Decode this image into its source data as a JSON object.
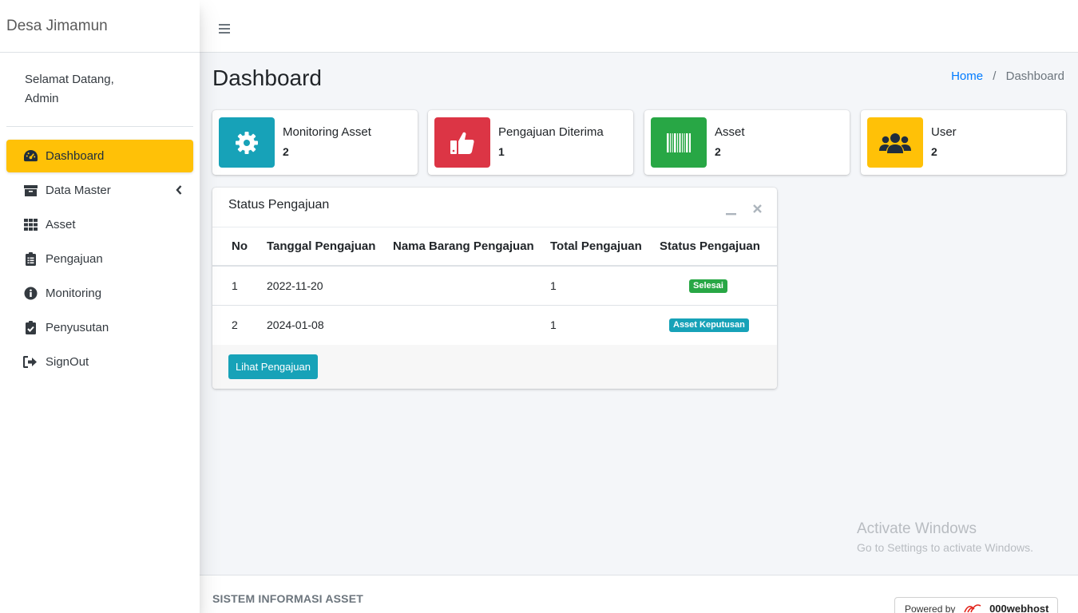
{
  "brand": "Desa Jimamun",
  "user_panel": {
    "line1": "Selamat Datang,",
    "line2": "Admin"
  },
  "sidebar": {
    "items": [
      {
        "label": "Dashboard",
        "icon": "tachometer-icon"
      },
      {
        "label": "Data Master",
        "icon": "archive-icon"
      },
      {
        "label": "Asset",
        "icon": "grid-icon"
      },
      {
        "label": "Pengajuan",
        "icon": "clipboard-list-icon"
      },
      {
        "label": "Monitoring",
        "icon": "info-circle-icon"
      },
      {
        "label": "Penyusutan",
        "icon": "clipboard-check-icon"
      },
      {
        "label": "SignOut",
        "icon": "sign-out-icon"
      }
    ]
  },
  "header": {
    "title": "Dashboard",
    "breadcrumb": [
      "Home",
      "Dashboard"
    ]
  },
  "info_boxes": [
    {
      "label": "Monitoring Asset",
      "value": "2",
      "color": "#17a2b8",
      "icon": "gear-icon"
    },
    {
      "label": "Pengajuan Diterima",
      "value": "1",
      "color": "#dc3545",
      "icon": "thumbs-up-icon"
    },
    {
      "label": "Asset",
      "value": "2",
      "color": "#28a745",
      "icon": "barcode-icon"
    },
    {
      "label": "User",
      "value": "2",
      "color": "#ffc107",
      "icon": "users-icon"
    }
  ],
  "card": {
    "title": "Status Pengajuan",
    "columns": [
      "No",
      "Tanggal Pengajuan",
      "Nama Barang Pengajuan",
      "Total Pengajuan",
      "Status Pengajuan"
    ],
    "rows": [
      {
        "no": "1",
        "tanggal": "2022-11-20",
        "nama": "",
        "total": "1",
        "status": "Selesai",
        "status_color": "#28a745"
      },
      {
        "no": "2",
        "tanggal": "2024-01-08",
        "nama": "",
        "total": "1",
        "status": "Asset Keputusan",
        "status_color": "#17a2b8"
      }
    ],
    "button_label": "Lihat Pengajuan"
  },
  "watermark": {
    "line1": "Activate Windows",
    "line2": "Go to Settings to activate Windows."
  },
  "footer": {
    "text": "SISTEM INFORMASI ASSET",
    "powered_label": "Powered by",
    "powered_brand": "000webhost"
  }
}
